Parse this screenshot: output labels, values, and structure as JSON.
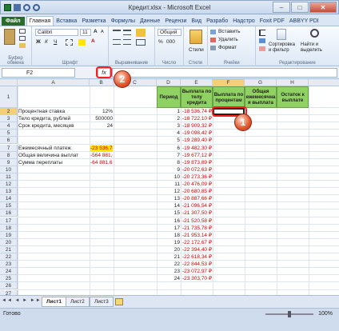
{
  "window": {
    "title": "Кредит.xlsx - Microsoft Excel"
  },
  "tabs": [
    "Файл",
    "Главная",
    "Вставка",
    "Разметка",
    "Формулы",
    "Данные",
    "Рецензи",
    "Вид",
    "Разрабо",
    "Надстро",
    "Foxit PDF",
    "ABBYY PDI"
  ],
  "ribbon": {
    "clipboard": "Буфер обмена",
    "font_name": "Calibri",
    "font_size": "11",
    "font_group": "Шрифт",
    "align_group": "Выравнивание",
    "number_format": "Общий",
    "number_group": "Число",
    "styles_label": "Стили",
    "insert": "Вставить",
    "delete": "Удалить",
    "format": "Формат",
    "cells_group": "Ячейки",
    "sort_filter": "Сортировка и фильтр",
    "find_select": "Найти и выделить",
    "editing_group": "Редактирование",
    "bold": "Ж",
    "italic": "К",
    "underline": "Ч",
    "font_color": "А",
    "percent": "%",
    "thousands": "000",
    "increase_font": "А",
    "decrease_font": "А"
  },
  "formula": {
    "namebox": "F2",
    "fx": "fx"
  },
  "columns": [
    "A",
    "B",
    "C",
    "D",
    "E",
    "F",
    "G",
    "H"
  ],
  "rows": [
    "1",
    "2",
    "3",
    "4",
    "5",
    "6",
    "7",
    "8",
    "9",
    "10",
    "11",
    "12",
    "13",
    "14",
    "15",
    "16",
    "17",
    "18",
    "19",
    "20",
    "21",
    "22",
    "23",
    "24",
    "25",
    "26",
    "27",
    "28"
  ],
  "left": {
    "rate_label": "Процентная ставка",
    "rate_value": "12%",
    "body_label": "Тело кредита, рублей",
    "body_value": "500000",
    "term_label": "Срок кредита, месяцев",
    "term_value": "24",
    "payment_label": "Ежемесячный платеж",
    "payment_value": "-23 536,74 ₽",
    "total_label": "Общая величина выплат",
    "total_value": "-564 881,67 ₽",
    "over_label": "Сумма переплаты",
    "over_value": "-64 881,67 ₽"
  },
  "table": {
    "headers": {
      "period": "Период",
      "body": "Выплата по телу кредита",
      "percent": "Выплата по процентам",
      "monthly": "Общая ежемесячна я выплата",
      "rest": "Остаток к выплате"
    },
    "periods": [
      "1",
      "2",
      "3",
      "4",
      "5",
      "6",
      "7",
      "8",
      "9",
      "10",
      "11",
      "12",
      "13",
      "14",
      "15",
      "16",
      "17",
      "18",
      "19",
      "20",
      "21",
      "22",
      "23",
      "24"
    ],
    "body_payments": [
      "-18 536,74 ₽",
      "-18 722,10 ₽",
      "-18 909,32 ₽",
      "-19 098,42 ₽",
      "-19 289,40 ₽",
      "-19 482,30 ₽",
      "-19 677,12 ₽",
      "-19 873,89 ₽",
      "-20 072,63 ₽",
      "-20 273,36 ₽",
      "-20 476,09 ₽",
      "-20 680,85 ₽",
      "-20 887,66 ₽",
      "-21 096,54 ₽",
      "-21 307,50 ₽",
      "-21 520,58 ₽",
      "-21 735,78 ₽",
      "-21 953,14 ₽",
      "-22 172,67 ₽",
      "-22 394,40 ₽",
      "-22 618,34 ₽",
      "-22 844,53 ₽",
      "-23 072,97 ₽",
      "-23 303,70 ₽"
    ]
  },
  "sheets": [
    "Лист1",
    "Лист2",
    "Лист3"
  ],
  "status": {
    "ready": "Готово",
    "zoom": "100%"
  },
  "callouts": {
    "one": "1",
    "two": "2"
  }
}
